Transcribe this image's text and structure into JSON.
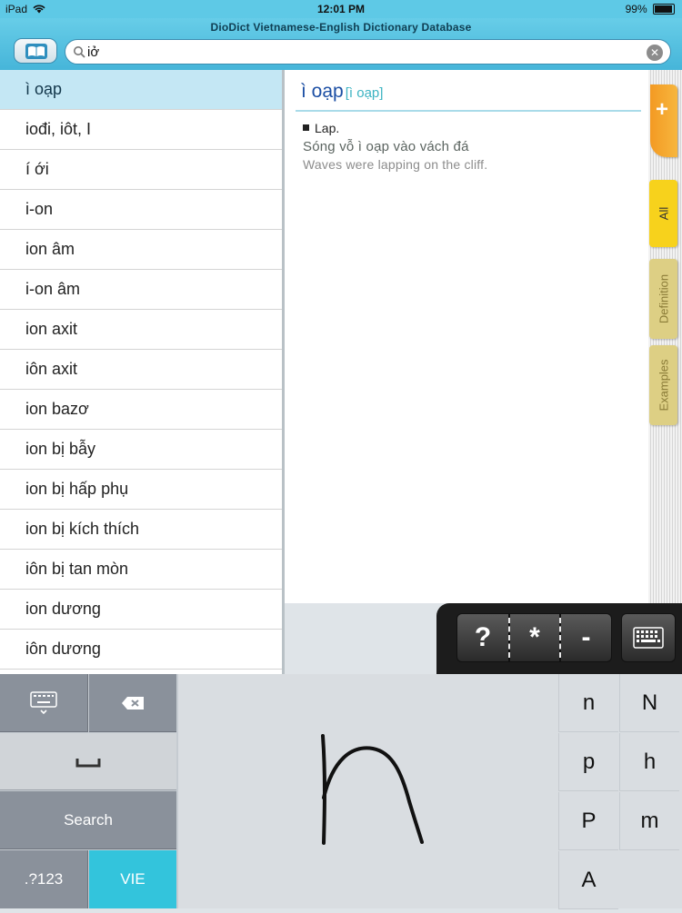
{
  "status": {
    "device": "iPad",
    "time": "12:01 PM",
    "battery": "99%"
  },
  "app": {
    "title": "DioDict Vietnamese-English Dictionary Database"
  },
  "search": {
    "value": "iở"
  },
  "wordlist": [
    "ì oạp",
    "iođi, iôt, I",
    "í ới",
    "i-on",
    "ion âm",
    "i-on âm",
    "ion axit",
    "iôn axit",
    "ion bazơ",
    "ion bị bẫy",
    "ion bị hấp phụ",
    "ion bị kích thích",
    "iôn bị tan mòn",
    "ion dương",
    "iôn dương"
  ],
  "entry": {
    "headword": "ì oạp",
    "pronunciation": "[ì oạp]",
    "sense": "Lap.",
    "example_vi": "Sóng vỗ ì oạp vào vách đá",
    "example_en": "Waves were lapping on the cliff."
  },
  "tabs": {
    "plus": "+",
    "all": "All",
    "definition": "Definition",
    "examples": "Examples"
  },
  "wildcards": {
    "question": "?",
    "star": "*",
    "dash": "-"
  },
  "keyboard": {
    "search": "Search",
    "numbers": ".?123",
    "language": "VIE"
  },
  "candidates": [
    "n",
    "N",
    "p",
    "h",
    "P",
    "m",
    "A"
  ]
}
